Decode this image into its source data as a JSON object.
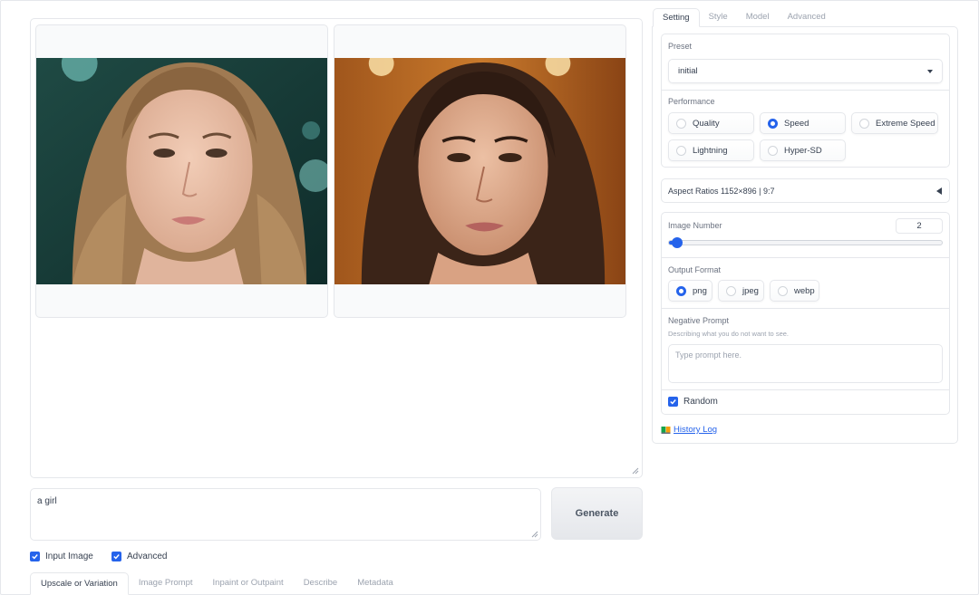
{
  "prompt": {
    "value": "a girl"
  },
  "generate_label": "Generate",
  "checkboxes": {
    "input_image": "Input Image",
    "advanced": "Advanced",
    "random": "Random"
  },
  "bottom_tabs": [
    "Upscale or Variation",
    "Image Prompt",
    "Inpaint or Outpaint",
    "Describe",
    "Metadata"
  ],
  "right_tabs": [
    "Setting",
    "Style",
    "Model",
    "Advanced"
  ],
  "preset": {
    "label": "Preset",
    "value": "initial"
  },
  "performance": {
    "label": "Performance",
    "options": [
      "Quality",
      "Speed",
      "Extreme Speed",
      "Lightning",
      "Hyper-SD"
    ],
    "selected": "Speed"
  },
  "aspect_ratios": {
    "text": "Aspect Ratios 1152×896 | 9:7"
  },
  "image_number": {
    "label": "Image Number",
    "value": "2",
    "fraction": 0.03
  },
  "output_format": {
    "label": "Output Format",
    "options": [
      "png",
      "jpeg",
      "webp"
    ],
    "selected": "png"
  },
  "negative_prompt": {
    "label": "Negative Prompt",
    "description": "Describing what you do not want to see.",
    "placeholder": "Type prompt here."
  },
  "history_log": "History Log",
  "accent_color": "#2563eb",
  "icons": [
    "checkbox-check-icon",
    "dropdown-caret-icon",
    "collapse-triangle-icon",
    "book-icon",
    "resize-grip-icon"
  ]
}
